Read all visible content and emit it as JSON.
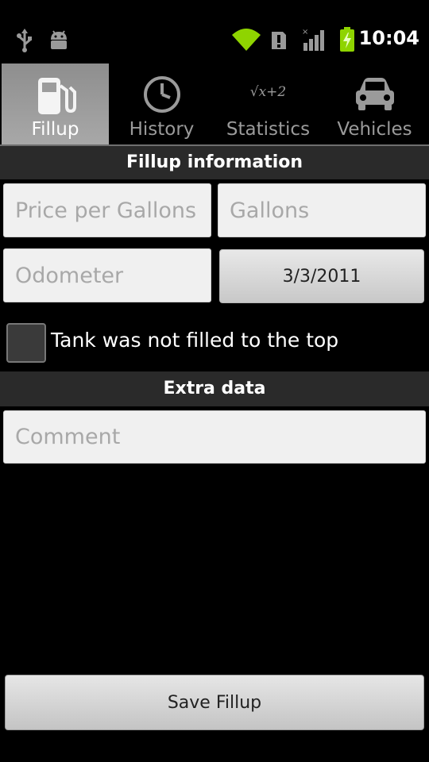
{
  "status_bar": {
    "time": "10:04",
    "icons": [
      "usb-icon",
      "android-debug-icon",
      "wifi-icon",
      "alert-icon",
      "signal-icon",
      "battery-charging-icon"
    ],
    "accent_color": "#8fd400"
  },
  "tabs": [
    {
      "label": "Fillup",
      "icon": "fuel-pump-icon",
      "selected": true
    },
    {
      "label": "History",
      "icon": "clock-icon",
      "selected": false
    },
    {
      "label": "Statistics",
      "icon": "sqrt-icon",
      "icon_text": "√x+2",
      "selected": false
    },
    {
      "label": "Vehicles",
      "icon": "car-icon",
      "selected": false
    }
  ],
  "fillup_section": {
    "title": "Fillup information",
    "price_placeholder": "Price per Gallons",
    "gallons_placeholder": "Gallons",
    "odometer_placeholder": "Odometer",
    "date": "3/3/2011",
    "tank_checkbox_label": "Tank was not filled to the top",
    "tank_checked": false
  },
  "extra_section": {
    "title": "Extra data",
    "comment_placeholder": "Comment"
  },
  "save_button_label": "Save Fillup"
}
